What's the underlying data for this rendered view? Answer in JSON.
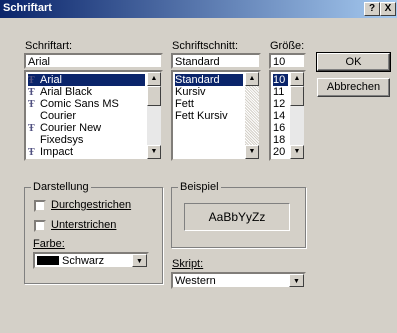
{
  "window": {
    "title": "Schriftart",
    "help_label": "?",
    "close_label": "X"
  },
  "font": {
    "label": "Schriftart:",
    "value": "Arial",
    "items": [
      "Arial",
      "Arial Black",
      "Comic Sans MS",
      "Courier",
      "Courier New",
      "Fixedsys",
      "Impact"
    ],
    "truetype": [
      true,
      true,
      true,
      false,
      true,
      false,
      true
    ],
    "selected": 0
  },
  "style": {
    "label": "Schriftschnitt:",
    "value": "Standard",
    "items": [
      "Standard",
      "Kursiv",
      "Fett",
      "Fett Kursiv"
    ],
    "selected": 0
  },
  "size": {
    "label": "Größe:",
    "value": "10",
    "items": [
      "10",
      "11",
      "12",
      "14",
      "16",
      "18",
      "20"
    ],
    "selected": 0
  },
  "buttons": {
    "ok": "OK",
    "cancel": "Abbrechen"
  },
  "effects": {
    "legend": "Darstellung",
    "strikeout": "Durchgestrichen",
    "underline": "Unterstrichen",
    "color_label": "Farbe:",
    "color_value": "Schwarz",
    "color_swatch": "#000000"
  },
  "sample": {
    "legend": "Beispiel",
    "text": "AaBbYyZz"
  },
  "script": {
    "label": "Skript:",
    "value": "Western"
  }
}
